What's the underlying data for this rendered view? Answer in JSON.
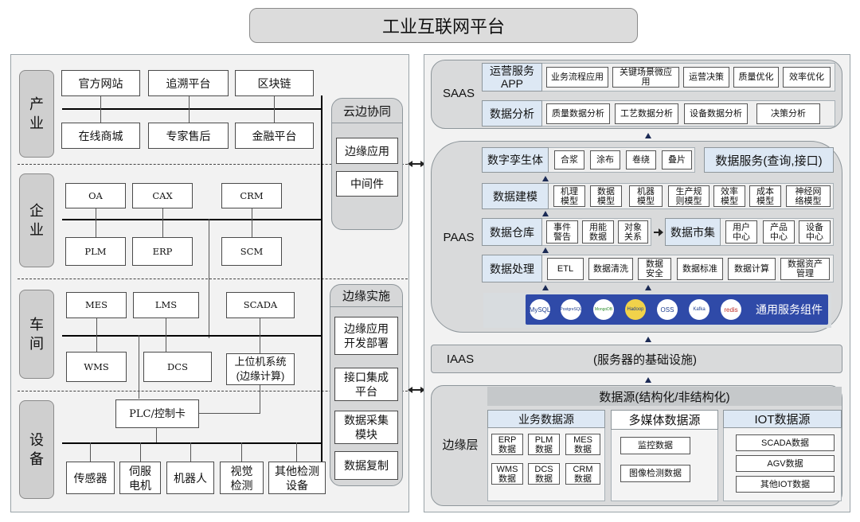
{
  "title": "工业互联网平台",
  "left": {
    "rows": [
      {
        "label": "产业"
      },
      {
        "label": "企业"
      },
      {
        "label": "车间"
      },
      {
        "label": "设备"
      }
    ],
    "industry": {
      "top": [
        "官方网站",
        "追溯平台",
        "区块链"
      ],
      "bottom": [
        "在线商城",
        "专家售后",
        "金融平台"
      ]
    },
    "enterprise": {
      "top": [
        "OA",
        "CAX",
        "CRM"
      ],
      "bottom": [
        "PLM",
        "ERP",
        "SCM"
      ]
    },
    "workshop": {
      "top": [
        "MES",
        "LMS",
        "SCADA"
      ],
      "bottom": [
        "WMS",
        "DCS",
        "上位机系统\n(边缘计算)"
      ]
    },
    "device": {
      "plc": "PLC/控制卡",
      "items": [
        "传感器",
        "伺服\n电机",
        "机器人",
        "视觉\n检测",
        "其他检测\n设备"
      ]
    },
    "cloud_edge": {
      "title": "云边协同",
      "items": [
        "边缘应用",
        "中间件"
      ]
    },
    "edge_impl": {
      "title": "边缘实施",
      "items": [
        "边缘应用\n开发部署",
        "接口集成\n平台",
        "数据采集\n模块",
        "数据复制"
      ]
    }
  },
  "right": {
    "saas": {
      "label": "SAAS",
      "row1": {
        "head": "运营服务\nAPP",
        "items": [
          "业务流程应用",
          "关键场景微应\n用",
          "运营决策",
          "质量优化",
          "效率优化"
        ]
      },
      "row2": {
        "head": "数据分析",
        "items": [
          "质量数据分析",
          "工艺数据分析",
          "设备数据分析",
          "决策分析"
        ]
      }
    },
    "paas": {
      "label": "PAAS",
      "twin": {
        "head": "数字孪生体",
        "items": [
          "合浆",
          "涂布",
          "卷绕",
          "叠片"
        ]
      },
      "data_service": "数据服务(查询,接口)",
      "modeling": {
        "head": "数据建模",
        "items": [
          "机理\n模型",
          "数据\n模型",
          "机器\n模型",
          "生产规\n则模型",
          "效率\n模型",
          "成本\n模型",
          "神经网\n络模型"
        ]
      },
      "warehouse": {
        "head": "数据仓库",
        "items": [
          "事件\n警告",
          "用能\n数据",
          "对象\n关系"
        ]
      },
      "market": {
        "head": "数据市集",
        "items": [
          "用户\n中心",
          "产品\n中心",
          "设备\n中心"
        ]
      },
      "processing": {
        "head": "数据处理",
        "items": [
          "ETL",
          "数据清洗",
          "数据\n安全",
          "数据标准",
          "数据计算",
          "数据资产\n管理"
        ]
      },
      "common": {
        "label": "通用服务组件",
        "icons": [
          "MySQL",
          "PostgreSQL",
          "MongoDB",
          "Hadoop",
          "OSS",
          "Kafka",
          "redis"
        ]
      }
    },
    "iaas": {
      "label": "IAAS",
      "desc": "(服务器的基础设施)"
    },
    "edge": {
      "label": "边缘层",
      "source": "数据源(结构化/非结构化)",
      "business": {
        "title": "业务数据源",
        "items": [
          "ERP\n数据",
          "PLM\n数据",
          "MES\n数据",
          "WMS\n数据",
          "DCS\n数据",
          "CRM\n数据"
        ]
      },
      "media": {
        "title": "多媒体数据源",
        "items": [
          "监控数据",
          "图像检测数据"
        ]
      },
      "iot": {
        "title": "IOT数据源",
        "items": [
          "SCADA数据",
          "AGV数据",
          "其他IOT数据"
        ]
      }
    }
  }
}
